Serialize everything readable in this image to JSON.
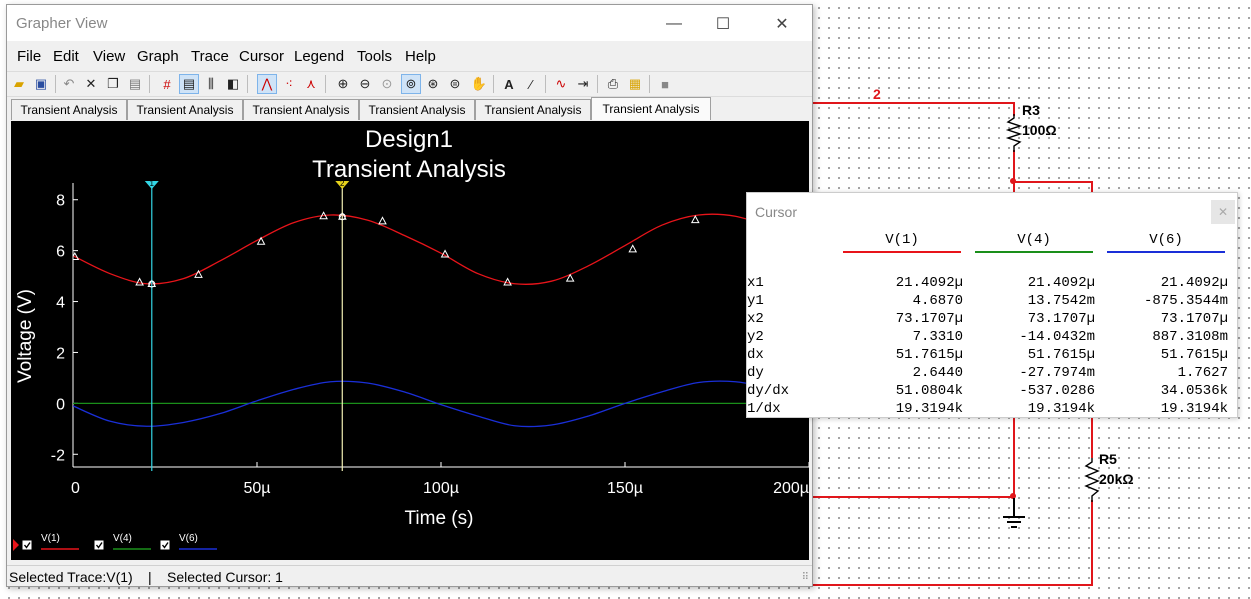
{
  "window": {
    "title": "Grapher View",
    "minimize_glyph": "—",
    "maximize_glyph": "☐",
    "close_glyph": "✕"
  },
  "menu": [
    "File",
    "Edit",
    "View",
    "Graph",
    "Trace",
    "Cursor",
    "Legend",
    "Tools",
    "Help"
  ],
  "toolbar_icons": [
    "open-icon",
    "save-icon",
    "undo-icon",
    "cut-icon",
    "copy-icon",
    "paste-icon",
    "grid-icon",
    "legend-icon",
    "cursors-icon",
    "overlay-icon",
    "line-trace-icon",
    "dots-trace-icon",
    "line-dots-trace-icon",
    "zoom-in-icon",
    "zoom-out-icon",
    "zoom-fit-icon",
    "zoom-area-icon",
    "zoom-x-icon",
    "zoom-y-icon",
    "pan-hand-icon",
    "text-icon",
    "label-icon",
    "compare-icon",
    "export-icon",
    "print-icon",
    "print-preview-icon",
    "stop-icon"
  ],
  "tabs": [
    {
      "label": "Transient Analysis",
      "active": false
    },
    {
      "label": "Transient Analysis",
      "active": false
    },
    {
      "label": "Transient Analysis",
      "active": false
    },
    {
      "label": "Transient Analysis",
      "active": false
    },
    {
      "label": "Transient Analysis",
      "active": false
    },
    {
      "label": "Transient Analysis",
      "active": true
    }
  ],
  "chart_data": {
    "type": "line",
    "title": "Design1",
    "subtitle": "Transient Analysis",
    "xlabel": "Time (s)",
    "ylabel": "Voltage (V)",
    "xlim": [
      0,
      0.0002
    ],
    "ylim": [
      -2.5,
      8.5
    ],
    "x_ticks": [
      {
        "value": 0,
        "label": "0"
      },
      {
        "value": 5e-05,
        "label": "50µ"
      },
      {
        "value": 0.0001,
        "label": "100µ"
      },
      {
        "value": 0.00015,
        "label": "150µ"
      },
      {
        "value": 0.0002,
        "label": "200µ"
      }
    ],
    "y_ticks": [
      {
        "value": 8,
        "label": "8"
      },
      {
        "value": 6,
        "label": "6"
      },
      {
        "value": 4,
        "label": "4"
      },
      {
        "value": 2,
        "label": "2"
      },
      {
        "value": 0,
        "label": "0"
      },
      {
        "value": -2,
        "label": "-2"
      }
    ],
    "grid": false,
    "background": "#000000",
    "series": [
      {
        "name": "V(1)",
        "color": "#e8141a",
        "x": [
          0,
          1e-05,
          2e-05,
          3e-05,
          4e-05,
          5e-05,
          6e-05,
          7e-05,
          8e-05,
          9e-05,
          0.0001,
          0.00011,
          0.00012,
          0.00013,
          0.00014,
          0.00015,
          0.00016,
          0.00017,
          0.00018,
          0.00019
        ],
        "y": [
          5.8,
          5.1,
          4.7,
          4.9,
          5.6,
          6.4,
          7.1,
          7.4,
          7.2,
          6.6,
          5.9,
          5.1,
          4.7,
          4.8,
          5.4,
          6.2,
          7.0,
          7.4,
          7.35,
          6.9
        ],
        "markers_x": [
          5e-07,
          1.81e-05,
          2.14e-05,
          3.41e-05,
          5.11e-05,
          6.81e-05,
          7.32e-05,
          8.41e-05,
          0.0001011,
          0.0001181,
          0.0001351,
          0.0001521,
          0.0001691,
          0.0001841
        ],
        "markers_y": [
          5.75,
          4.75,
          4.687,
          5.05,
          6.35,
          7.35,
          7.331,
          7.15,
          5.85,
          4.75,
          4.9,
          6.05,
          7.2,
          7.25
        ]
      },
      {
        "name": "V(4)",
        "color": "#1a8f1a",
        "x": [
          0,
          0.0001,
          0.0002
        ],
        "y": [
          0,
          0,
          0
        ]
      },
      {
        "name": "V(6)",
        "color": "#1a2fd8",
        "x": [
          0,
          1e-05,
          2e-05,
          3e-05,
          4e-05,
          5e-05,
          6e-05,
          7e-05,
          8e-05,
          9e-05,
          0.0001,
          0.00011,
          0.00012,
          0.00013,
          0.00014,
          0.00015,
          0.00016,
          0.00017,
          0.00018,
          0.00019
        ],
        "y": [
          -0.1,
          -0.7,
          -0.9,
          -0.75,
          -0.4,
          0.1,
          0.55,
          0.85,
          0.8,
          0.45,
          -0.05,
          -0.5,
          -0.88,
          -0.85,
          -0.5,
          0.0,
          0.45,
          0.82,
          0.85,
          0.6
        ]
      }
    ],
    "cursors": [
      {
        "label": "1",
        "x": 2.14092e-05,
        "color": "#33d6e6",
        "marker_color": "#33d6e6"
      },
      {
        "label": "2",
        "x": 7.31707e-05,
        "color": "#f2f0b5",
        "marker_color": "#e6d21c"
      }
    ],
    "legend": [
      {
        "label": "V(1)",
        "color": "#e8141a",
        "checked": true
      },
      {
        "label": "V(4)",
        "color": "#1a8f1a",
        "checked": true
      },
      {
        "label": "V(6)",
        "color": "#1a2fd8",
        "checked": true
      }
    ],
    "legend_position": "bottom-left"
  },
  "status": {
    "selected_trace": "Selected Trace:V(1)",
    "separator": "|",
    "selected_cursor": "Selected Cursor: 1"
  },
  "cursor_panel": {
    "title": "Cursor",
    "close_glyph": "✕",
    "columns": [
      {
        "name": "V(1)",
        "color": "#e8141a"
      },
      {
        "name": "V(4)",
        "color": "#1a8f1a"
      },
      {
        "name": "V(6)",
        "color": "#1a2fd8"
      }
    ],
    "rows": [
      {
        "label": "x1",
        "values": [
          "21.4092µ",
          "21.4092µ",
          "21.4092µ"
        ]
      },
      {
        "label": "y1",
        "values": [
          "4.6870",
          "13.7542m",
          "-875.3544m"
        ]
      },
      {
        "label": "x2",
        "values": [
          "73.1707µ",
          "73.1707µ",
          "73.1707µ"
        ]
      },
      {
        "label": "y2",
        "values": [
          "7.3310",
          "-14.0432m",
          "887.3108m"
        ]
      },
      {
        "label": "dx",
        "values": [
          "51.7615µ",
          "51.7615µ",
          "51.7615µ"
        ]
      },
      {
        "label": "dy",
        "values": [
          "2.6440",
          "-27.7974m",
          "1.7627"
        ]
      },
      {
        "label": "dy/dx",
        "values": [
          "51.0804k",
          "-537.0286",
          "34.0536k"
        ]
      },
      {
        "label": "1/dx",
        "values": [
          "19.3194k",
          "19.3194k",
          "19.3194k"
        ]
      }
    ]
  },
  "schematic": {
    "node_label": "2",
    "r3_name": "R3",
    "r3_value": "100Ω",
    "r5_name": "R5",
    "r5_value": "20kΩ",
    "wire_color": "#e0161b"
  }
}
